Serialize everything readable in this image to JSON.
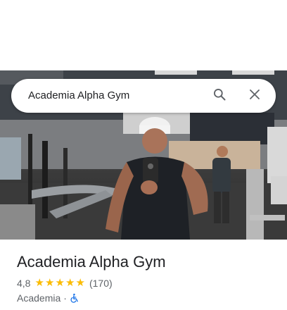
{
  "search": {
    "query": "Academia Alpha Gym",
    "search_icon": "search-icon",
    "close_icon": "close-icon"
  },
  "place": {
    "title": "Academia Alpha Gym",
    "rating": "4,8",
    "stars": 5,
    "review_count": "(170)",
    "category": "Academia",
    "separator": "·",
    "accessibility_icon": "wheelchair-accessible-icon"
  },
  "colors": {
    "star": "#fbbc04",
    "accessibility": "#1a73e8",
    "text_primary": "#202124",
    "text_secondary": "#5f6368"
  }
}
